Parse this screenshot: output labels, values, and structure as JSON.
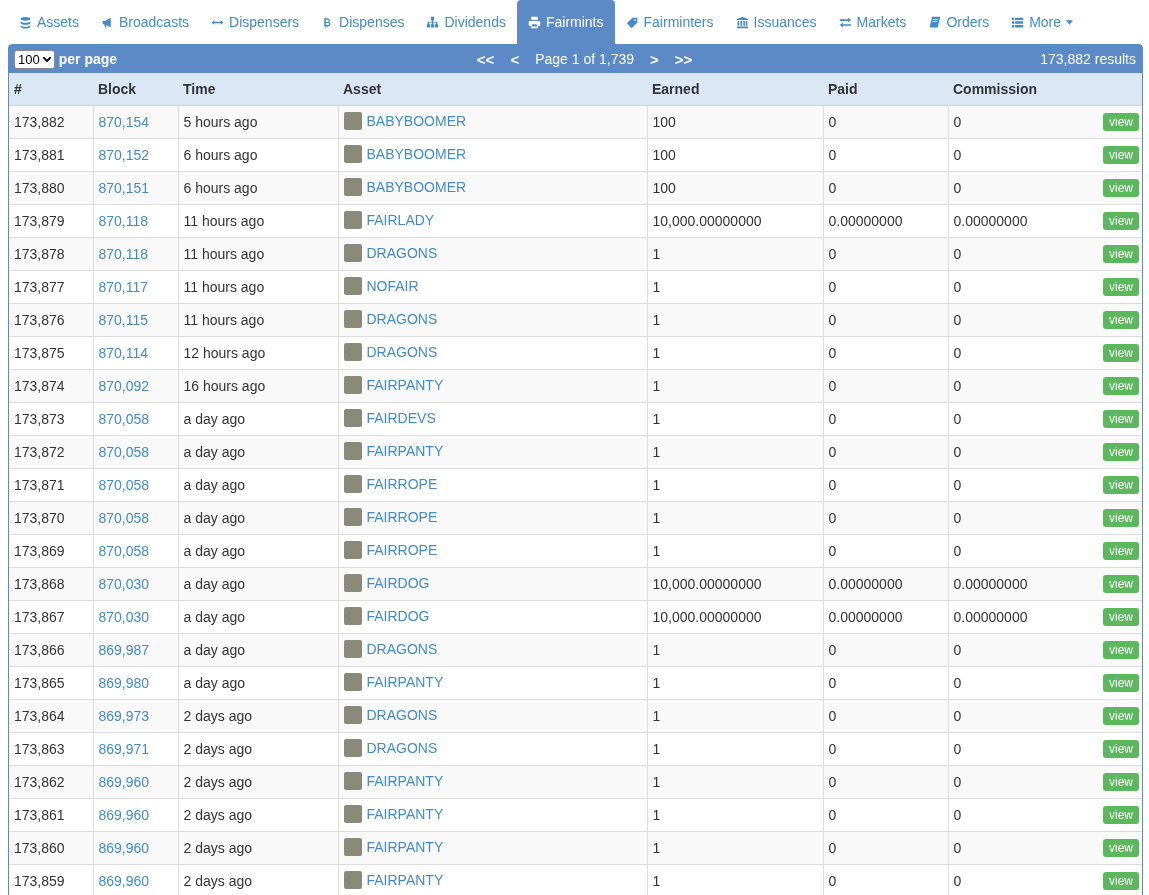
{
  "tabs": [
    {
      "label": "Assets",
      "selected": false
    },
    {
      "label": "Broadcasts",
      "selected": false
    },
    {
      "label": "Dispensers",
      "selected": false
    },
    {
      "label": "Dispenses",
      "selected": false
    },
    {
      "label": "Dividends",
      "selected": false
    },
    {
      "label": "Fairmints",
      "selected": true
    },
    {
      "label": "Fairminters",
      "selected": false
    },
    {
      "label": "Issuances",
      "selected": false
    },
    {
      "label": "Markets",
      "selected": false
    },
    {
      "label": "Orders",
      "selected": false
    },
    {
      "label": "More",
      "selected": false,
      "dropdown": true
    }
  ],
  "toolbar": {
    "page_size": "100",
    "page_size_label": "per page",
    "first": "<<",
    "prev": "<",
    "page_label": "Page 1 of 1,739",
    "next": ">",
    "last": ">>",
    "results": "173,882 results"
  },
  "table": {
    "columns": [
      "#",
      "Block",
      "Time",
      "Asset",
      "Earned",
      "Paid",
      "Commission"
    ],
    "rows": [
      {
        "num": "173,882",
        "block": "870,154",
        "time": "5 hours ago",
        "asset": "BABYBOOMER",
        "earned": "100",
        "paid": "0",
        "commission": "0",
        "action": "view"
      },
      {
        "num": "173,881",
        "block": "870,152",
        "time": "6 hours ago",
        "asset": "BABYBOOMER",
        "earned": "100",
        "paid": "0",
        "commission": "0",
        "action": "view"
      },
      {
        "num": "173,880",
        "block": "870,151",
        "time": "6 hours ago",
        "asset": "BABYBOOMER",
        "earned": "100",
        "paid": "0",
        "commission": "0",
        "action": "view"
      },
      {
        "num": "173,879",
        "block": "870,118",
        "time": "11 hours ago",
        "asset": "FAIRLADY",
        "earned": "10,000.00000000",
        "paid": "0.00000000",
        "commission": "0.00000000",
        "action": "view"
      },
      {
        "num": "173,878",
        "block": "870,118",
        "time": "11 hours ago",
        "asset": "DRAGONS",
        "earned": "1",
        "paid": "0",
        "commission": "0",
        "action": "view"
      },
      {
        "num": "173,877",
        "block": "870,117",
        "time": "11 hours ago",
        "asset": "NOFAIR",
        "earned": "1",
        "paid": "0",
        "commission": "0",
        "action": "view"
      },
      {
        "num": "173,876",
        "block": "870,115",
        "time": "11 hours ago",
        "asset": "DRAGONS",
        "earned": "1",
        "paid": "0",
        "commission": "0",
        "action": "view"
      },
      {
        "num": "173,875",
        "block": "870,114",
        "time": "12 hours ago",
        "asset": "DRAGONS",
        "earned": "1",
        "paid": "0",
        "commission": "0",
        "action": "view"
      },
      {
        "num": "173,874",
        "block": "870,092",
        "time": "16 hours ago",
        "asset": "FAIRPANTY",
        "earned": "1",
        "paid": "0",
        "commission": "0",
        "action": "view"
      },
      {
        "num": "173,873",
        "block": "870,058",
        "time": "a day ago",
        "asset": "FAIRDEVS",
        "earned": "1",
        "paid": "0",
        "commission": "0",
        "action": "view"
      },
      {
        "num": "173,872",
        "block": "870,058",
        "time": "a day ago",
        "asset": "FAIRPANTY",
        "earned": "1",
        "paid": "0",
        "commission": "0",
        "action": "view"
      },
      {
        "num": "173,871",
        "block": "870,058",
        "time": "a day ago",
        "asset": "FAIRROPE",
        "earned": "1",
        "paid": "0",
        "commission": "0",
        "action": "view"
      },
      {
        "num": "173,870",
        "block": "870,058",
        "time": "a day ago",
        "asset": "FAIRROPE",
        "earned": "1",
        "paid": "0",
        "commission": "0",
        "action": "view"
      },
      {
        "num": "173,869",
        "block": "870,058",
        "time": "a day ago",
        "asset": "FAIRROPE",
        "earned": "1",
        "paid": "0",
        "commission": "0",
        "action": "view"
      },
      {
        "num": "173,868",
        "block": "870,030",
        "time": "a day ago",
        "asset": "FAIRDOG",
        "earned": "10,000.00000000",
        "paid": "0.00000000",
        "commission": "0.00000000",
        "action": "view"
      },
      {
        "num": "173,867",
        "block": "870,030",
        "time": "a day ago",
        "asset": "FAIRDOG",
        "earned": "10,000.00000000",
        "paid": "0.00000000",
        "commission": "0.00000000",
        "action": "view"
      },
      {
        "num": "173,866",
        "block": "869,987",
        "time": "a day ago",
        "asset": "DRAGONS",
        "earned": "1",
        "paid": "0",
        "commission": "0",
        "action": "view"
      },
      {
        "num": "173,865",
        "block": "869,980",
        "time": "a day ago",
        "asset": "FAIRPANTY",
        "earned": "1",
        "paid": "0",
        "commission": "0",
        "action": "view"
      },
      {
        "num": "173,864",
        "block": "869,973",
        "time": "2 days ago",
        "asset": "DRAGONS",
        "earned": "1",
        "paid": "0",
        "commission": "0",
        "action": "view"
      },
      {
        "num": "173,863",
        "block": "869,971",
        "time": "2 days ago",
        "asset": "DRAGONS",
        "earned": "1",
        "paid": "0",
        "commission": "0",
        "action": "view"
      },
      {
        "num": "173,862",
        "block": "869,960",
        "time": "2 days ago",
        "asset": "FAIRPANTY",
        "earned": "1",
        "paid": "0",
        "commission": "0",
        "action": "view"
      },
      {
        "num": "173,861",
        "block": "869,960",
        "time": "2 days ago",
        "asset": "FAIRPANTY",
        "earned": "1",
        "paid": "0",
        "commission": "0",
        "action": "view"
      },
      {
        "num": "173,860",
        "block": "869,960",
        "time": "2 days ago",
        "asset": "FAIRPANTY",
        "earned": "1",
        "paid": "0",
        "commission": "0",
        "action": "view"
      },
      {
        "num": "173,859",
        "block": "869,960",
        "time": "2 days ago",
        "asset": "FAIRPANTY",
        "earned": "1",
        "paid": "0",
        "commission": "0",
        "action": "view"
      }
    ]
  }
}
